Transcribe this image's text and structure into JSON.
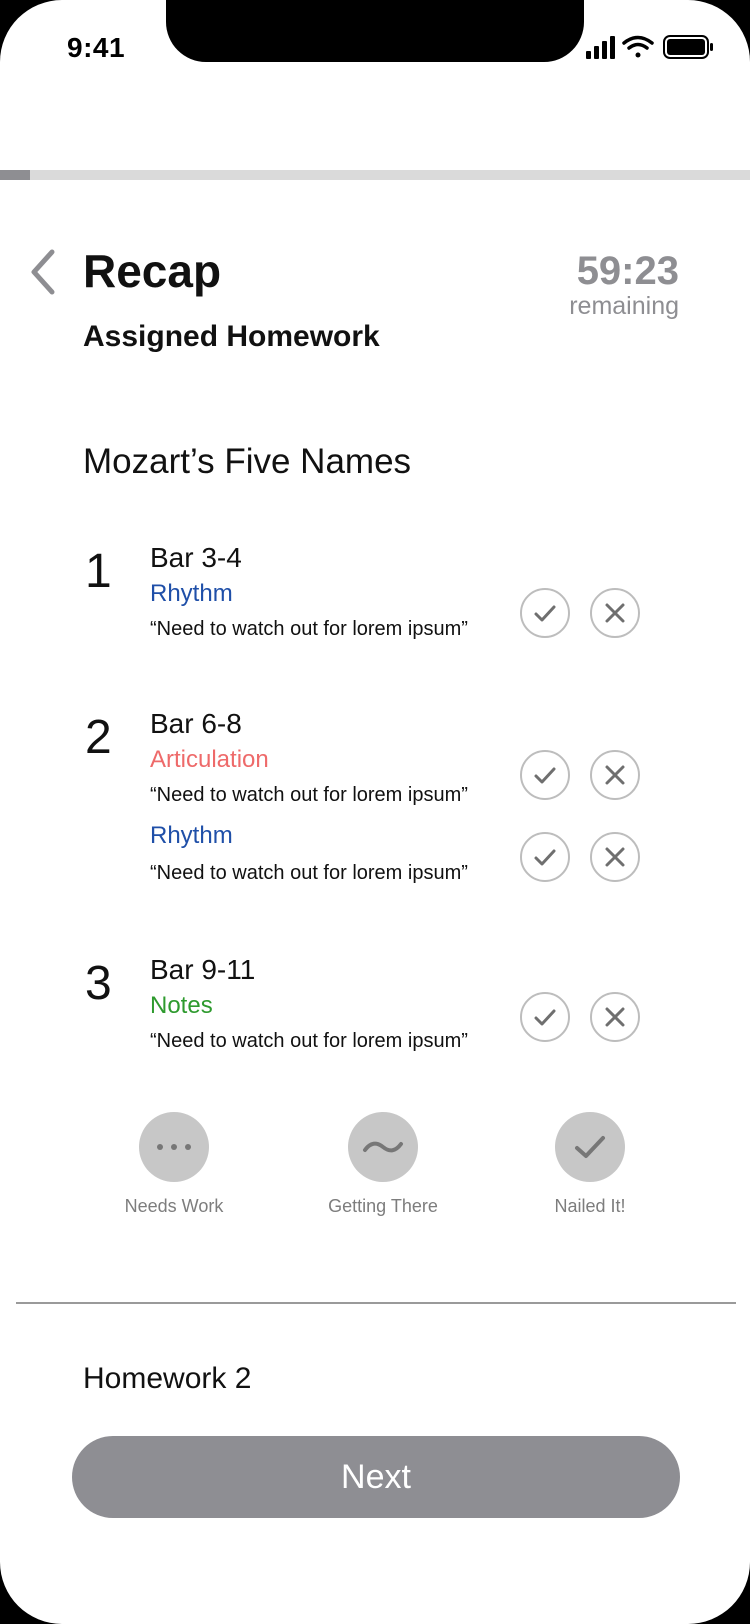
{
  "status_bar": {
    "time": "9:41"
  },
  "progress": {
    "fraction": 0.04
  },
  "header": {
    "title": "Recap",
    "subtitle": "Assigned Homework",
    "timer": {
      "value": "59:23",
      "caption": "remaining"
    }
  },
  "piece_title": "Mozart’s Five Names",
  "items": [
    {
      "number": "1",
      "bar": "Bar 3-4",
      "notes": [
        {
          "category": "Rhythm",
          "color": "#1f4fa8",
          "comment": "“Need to watch out for lorem ipsum”"
        }
      ]
    },
    {
      "number": "2",
      "bar": "Bar 6-8",
      "notes": [
        {
          "category": "Articulation",
          "color": "#ee6a6a",
          "comment": "“Need to watch out for lorem ipsum”"
        },
        {
          "category": "Rhythm",
          "color": "#1f4fa8",
          "comment": "“Need to watch out for lorem ipsum”"
        }
      ]
    },
    {
      "number": "3",
      "bar": "Bar 9-11",
      "notes": [
        {
          "category": "Notes",
          "color": "#2e9a2e",
          "comment": "“Need to watch out for lorem ipsum”"
        }
      ]
    }
  ],
  "ratings": [
    {
      "label": "Needs Work",
      "icon": "more-dots-icon"
    },
    {
      "label": "Getting There",
      "icon": "tilde-icon"
    },
    {
      "label": "Nailed It!",
      "icon": "checkmark-icon"
    }
  ],
  "next_section": "Homework 2",
  "next_button": "Next",
  "colors": {
    "progress_fill": "#8e8e92",
    "button": "#8e8e93",
    "rating_circle": "#c7c7c7"
  }
}
